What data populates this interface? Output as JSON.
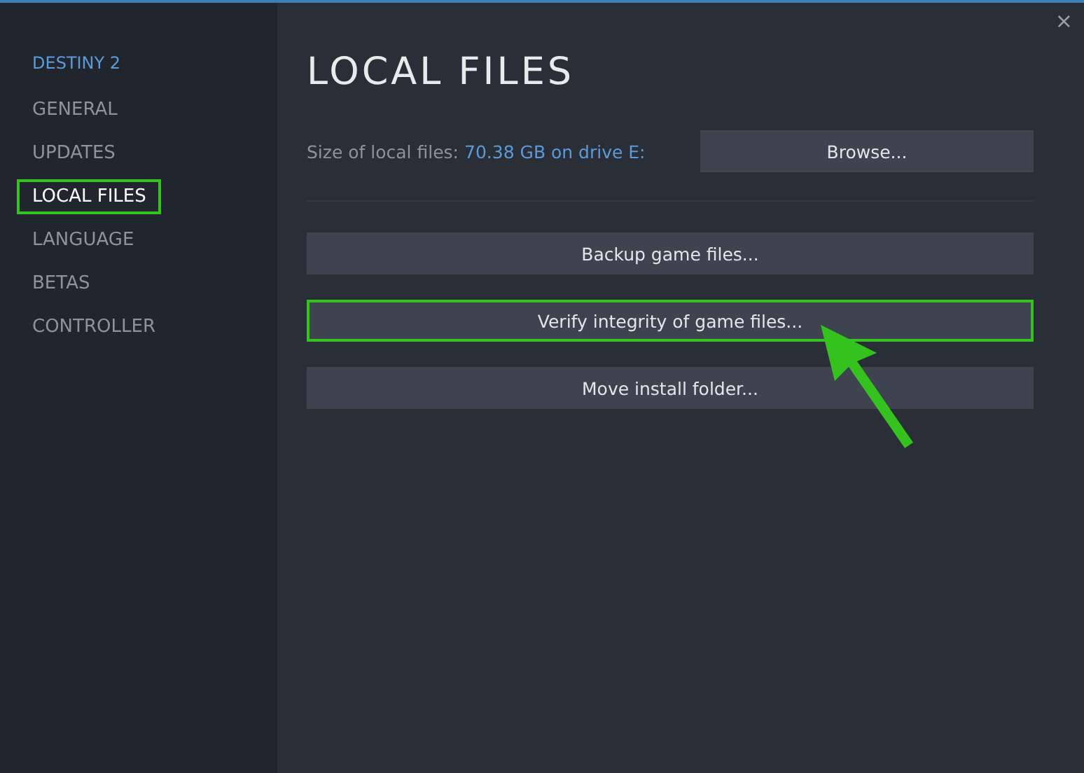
{
  "window": {
    "close": "×"
  },
  "sidebar": {
    "game": "DESTINY 2",
    "items": [
      {
        "label": "GENERAL",
        "selected": false
      },
      {
        "label": "UPDATES",
        "selected": false
      },
      {
        "label": "LOCAL FILES",
        "selected": true
      },
      {
        "label": "LANGUAGE",
        "selected": false
      },
      {
        "label": "BETAS",
        "selected": false
      },
      {
        "label": "CONTROLLER",
        "selected": false
      }
    ]
  },
  "main": {
    "title": "LOCAL FILES",
    "size_label": "Size of local files:",
    "size_value": "70.38 GB on drive E:",
    "browse": "Browse...",
    "buttons": [
      {
        "label": "Backup game files...",
        "highlighted": false
      },
      {
        "label": "Verify integrity of game files...",
        "highlighted": true
      },
      {
        "label": "Move install folder...",
        "highlighted": false
      }
    ]
  }
}
